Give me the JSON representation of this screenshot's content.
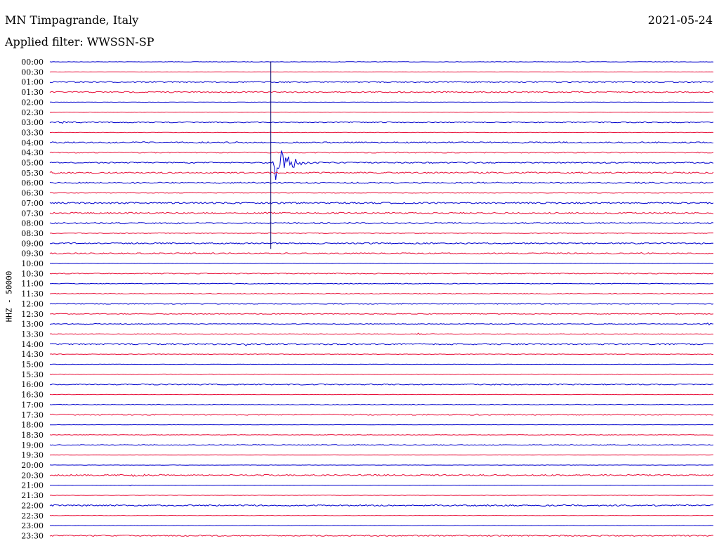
{
  "header": {
    "station": "MN Timpagrande, Italy",
    "filter": "Applied filter: WWSSN-SP",
    "date": "2021-05-24",
    "channel": "HHZ - 50000"
  },
  "colors": {
    "blue": "#0000cc",
    "red": "#e8103a"
  },
  "chart_data": {
    "type": "line",
    "title": "MN Timpagrande, Italy",
    "subtitle": "Applied filter: WWSSN-SP",
    "ylabel": "HHZ - 50000",
    "rows": [
      "00:00",
      "00:30",
      "01:00",
      "01:30",
      "02:00",
      "02:30",
      "03:00",
      "03:30",
      "04:00",
      "04:30",
      "05:00",
      "05:30",
      "06:00",
      "06:30",
      "07:00",
      "07:30",
      "08:00",
      "08:30",
      "09:00",
      "09:30",
      "10:00",
      "10:30",
      "11:00",
      "11:30",
      "12:00",
      "12:30",
      "13:00",
      "13:30",
      "14:00",
      "14:30",
      "15:00",
      "15:30",
      "16:00",
      "16:30",
      "17:00",
      "17:30",
      "18:00",
      "18:30",
      "19:00",
      "19:30",
      "20:00",
      "20:30",
      "21:00",
      "21:30",
      "22:00",
      "22:30",
      "23:00",
      "23:30"
    ],
    "row_colors": [
      "blue",
      "red"
    ],
    "noise_level": [
      0.3,
      0.2,
      0.8,
      0.9,
      0.2,
      0.3,
      0.7,
      0.3,
      1.0,
      0.8,
      0.9,
      1.0,
      1.0,
      0.5,
      1.1,
      1.0,
      1.0,
      0.5,
      0.9,
      0.9,
      0.2,
      0.7,
      0.5,
      0.6,
      0.7,
      0.6,
      0.5,
      0.5,
      1.0,
      0.4,
      0.3,
      0.5,
      0.8,
      0.3,
      0.5,
      0.9,
      0.2,
      0.4,
      0.6,
      0.2,
      0.2,
      1.0,
      0.2,
      0.3,
      1.0,
      0.3,
      0.3,
      0.9
    ],
    "events": [
      {
        "row": 6,
        "t": 0.01,
        "amp": 3,
        "dur": 0.05
      },
      {
        "row": 10,
        "t": 0.335,
        "amp": 38,
        "dur": 0.06
      },
      {
        "row": 10,
        "t": 0.57,
        "amp": 2,
        "dur": 0.01
      },
      {
        "row": 11,
        "t": 0.0,
        "amp": 3,
        "dur": 0.03
      },
      {
        "row": 19,
        "t": 0.89,
        "amp": 3,
        "dur": 0.03
      },
      {
        "row": 26,
        "t": 0.05,
        "amp": 2,
        "dur": 0.04
      },
      {
        "row": 26,
        "t": 0.99,
        "amp": 5,
        "dur": 0.01
      },
      {
        "row": 28,
        "t": 0.295,
        "amp": 4,
        "dur": 0.005
      },
      {
        "row": 27,
        "t": 0.55,
        "amp": 2,
        "dur": 0.05
      },
      {
        "row": 41,
        "t": 0.12,
        "amp": 3,
        "dur": 0.05
      },
      {
        "row": 42,
        "t": 0.12,
        "amp": 2,
        "dur": 0.01
      }
    ],
    "marker": {
      "t": 0.333,
      "from_row": 4,
      "to_row": 18
    }
  }
}
